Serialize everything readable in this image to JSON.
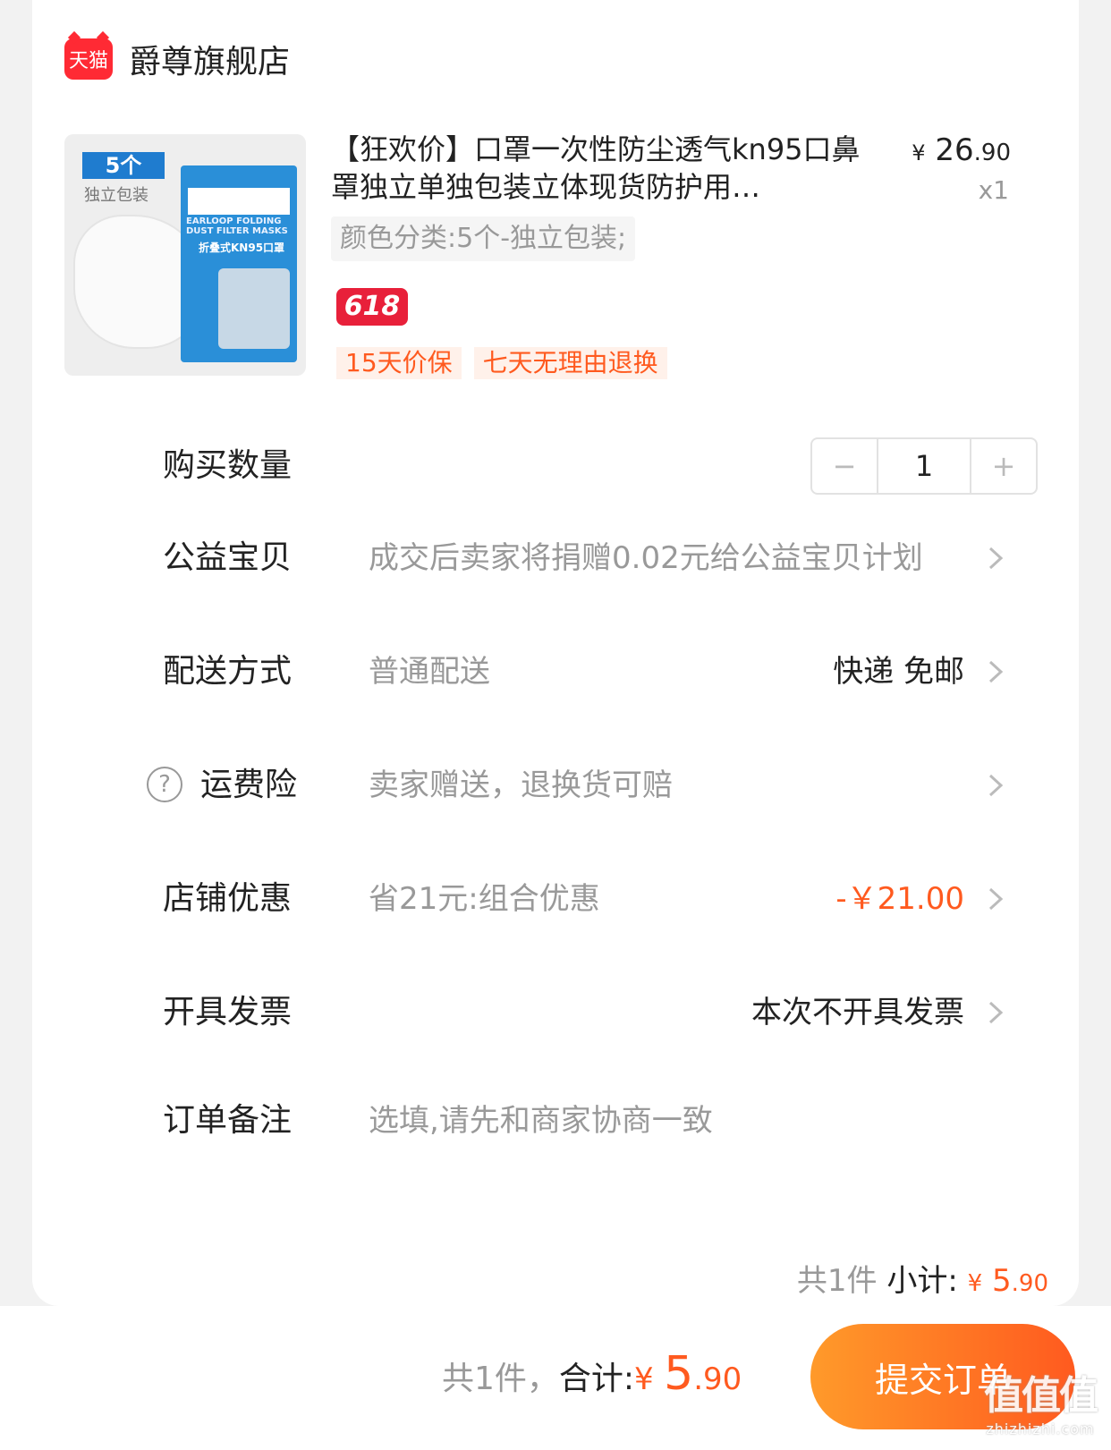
{
  "shop": {
    "platform_logo": "天猫",
    "name": "爵尊旗舰店"
  },
  "product": {
    "thumb_badge": "5个",
    "thumb_sub": "独立包装",
    "thumb_pack_line1": "EARLOOP FOLDING DUST FILTER MASKS",
    "thumb_pack_line2": "折叠式KN95口罩",
    "title": "【狂欢价】口罩一次性防尘透气kn95口鼻罩独立单独包装立体现货防护用…",
    "price_symbol": "¥",
    "price_int": "26",
    "price_dec": ".90",
    "qty": "x1",
    "sku": "颜色分类:5个-独立包装;",
    "promo_tag": "618",
    "service_tags": [
      "15天价保",
      "七天无理由退换"
    ]
  },
  "rows": {
    "quantity": {
      "label": "购买数量",
      "minus": "−",
      "value": "1",
      "plus": "+"
    },
    "charity": {
      "label": "公益宝贝",
      "desc": "成交后卖家将捐赠0.02元给公益宝贝计划"
    },
    "delivery": {
      "label": "配送方式",
      "desc": "普通配送",
      "value": "快递 免邮"
    },
    "insurance": {
      "label": "运费险",
      "desc": "卖家赠送，退换货可赔"
    },
    "discount": {
      "label": "店铺优惠",
      "desc": "省21元:组合优惠",
      "value": "-￥21.00"
    },
    "invoice": {
      "label": "开具发票",
      "value": "本次不开具发票"
    },
    "note": {
      "label": "订单备注",
      "placeholder": "选填,请先和商家协商一致"
    }
  },
  "subtotal": {
    "count_text": "共1件",
    "label": "小计:",
    "symbol": "¥",
    "int": "5",
    "dec": ".90"
  },
  "footer": {
    "count_text": "共1件，",
    "label": "合计:",
    "symbol": "¥",
    "int": "5",
    "dec": ".90",
    "submit": "提交订单"
  },
  "watermark": {
    "logo": "值值值",
    "url": "zhizhizhi.com"
  },
  "colors": {
    "accent": "#ff5a1f",
    "tmall_red": "#ff2a34",
    "tag_bg": "#fff1ea"
  }
}
